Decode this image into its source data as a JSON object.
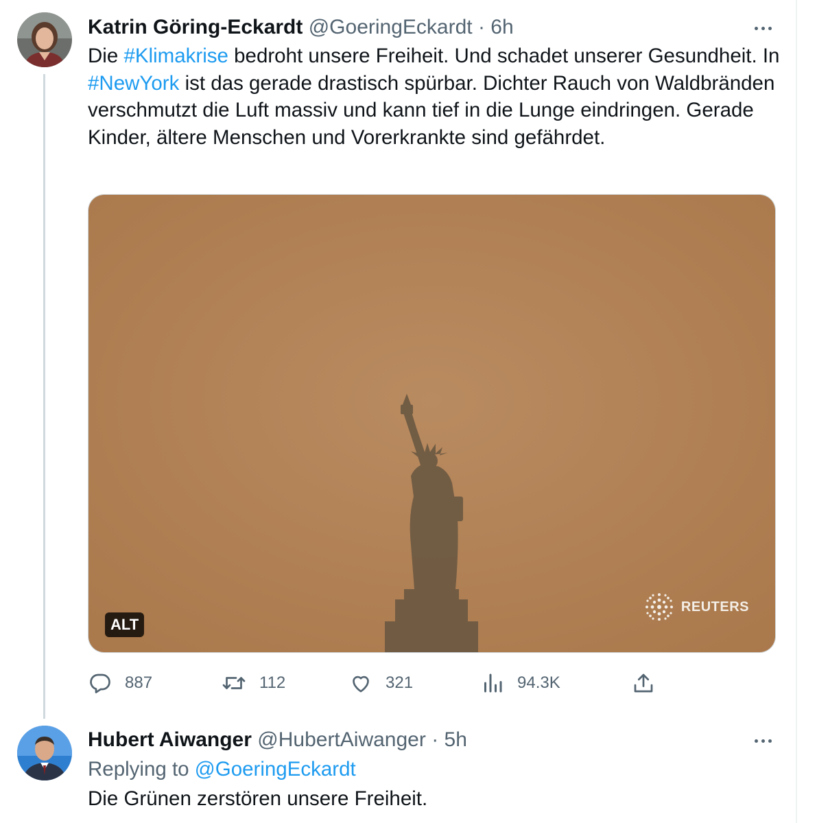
{
  "tweet": {
    "author": {
      "name": "Katrin Göring-Eckardt",
      "handle": "@GoeringEckardt",
      "separator": "·",
      "time": "6h"
    },
    "text": [
      {
        "t": "Die ",
        "k": "text"
      },
      {
        "t": "#Klimakrise",
        "k": "hashtag"
      },
      {
        "t": " bedroht unsere Freiheit. Und schadet unserer Gesundheit. In ",
        "k": "text"
      },
      {
        "t": "#NewYork",
        "k": "hashtag"
      },
      {
        "t": " ist das gerade drastisch spürbar. Dichter Rauch von Waldbränden verschmutzt die Luft massiv und kann tief in die Lunge eindringen. Gerade Kinder, ältere Menschen und Vorerkrankte sind gefährdet.",
        "k": "text"
      }
    ],
    "media": {
      "alt_label": "ALT",
      "watermark": "REUTERS",
      "colors": {
        "haze": "#b5865a",
        "statue": "#6e5a43"
      }
    },
    "stats": {
      "replies": "887",
      "retweets": "112",
      "likes": "321",
      "views": "94.3K"
    }
  },
  "reply": {
    "author": {
      "name": "Hubert Aiwanger",
      "handle": "@HubertAiwanger",
      "separator": "·",
      "time": "5h"
    },
    "replying_prefix": "Replying to",
    "replying_to": "@GoeringEckardt",
    "text": "Die Grünen zerstören unsere Freiheit."
  },
  "icons": [
    "more-icon",
    "reply-icon",
    "retweet-icon",
    "like-icon",
    "views-icon",
    "share-icon",
    "reuters-logo-icon"
  ],
  "colors": {
    "link": "#1d9bf0",
    "secondary_text": "#536471",
    "primary_text": "#0f1419",
    "thread_line": "#cfd9de"
  }
}
